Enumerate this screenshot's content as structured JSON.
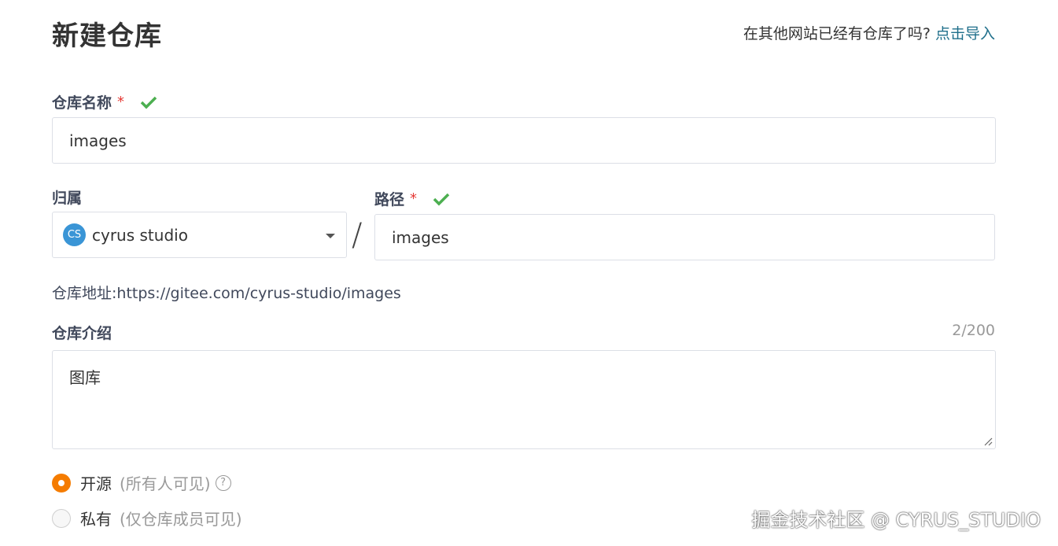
{
  "header": {
    "title": "新建仓库",
    "import_hint": "在其他网站已经有仓库了吗?",
    "import_link": "点击导入"
  },
  "repo_name": {
    "label": "仓库名称",
    "required_mark": "*",
    "value": "images"
  },
  "owner": {
    "label": "归属",
    "avatar_text": "CS",
    "value": "cyrus studio"
  },
  "separator": "/",
  "path": {
    "label": "路径",
    "required_mark": "*",
    "value": "images"
  },
  "repo_address": {
    "text": "仓库地址:https://gitee.com/cyrus-studio/images"
  },
  "description": {
    "label": "仓库介绍",
    "count": "2/200",
    "value": "图库"
  },
  "visibility": {
    "options": [
      {
        "label": "开源",
        "hint": "(所有人可见)",
        "selected": true
      },
      {
        "label": "私有",
        "hint": "(仅仓库成员可见)",
        "selected": false
      }
    ],
    "help_symbol": "?"
  },
  "watermark": "掘金技术社区 @ CYRUS_STUDIO",
  "colors": {
    "accent_link": "#1f6f8b",
    "valid_check": "#4caf50",
    "required": "#e53935",
    "radio_selected": "#f57c00",
    "avatar_bg": "#3a95d6"
  },
  "icons": {
    "valid": "check-icon",
    "dropdown": "caret-down-icon",
    "help": "help-icon",
    "resize": "resize-handle-icon"
  }
}
